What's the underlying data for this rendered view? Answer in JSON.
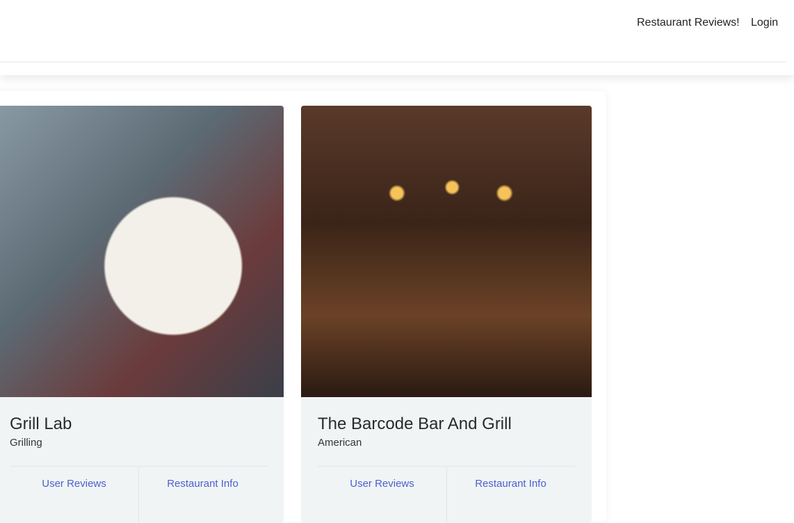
{
  "nav": {
    "brand_link": "Restaurant Reviews!",
    "login": "Login"
  },
  "cards": [
    {
      "name": "Grill Lab",
      "cuisine": "Grilling",
      "reviews_link": "User Reviews",
      "info_link": "Restaurant Info"
    },
    {
      "name": "The Barcode Bar And Grill",
      "cuisine": "American",
      "reviews_link": "User Reviews",
      "info_link": "Restaurant Info"
    }
  ]
}
